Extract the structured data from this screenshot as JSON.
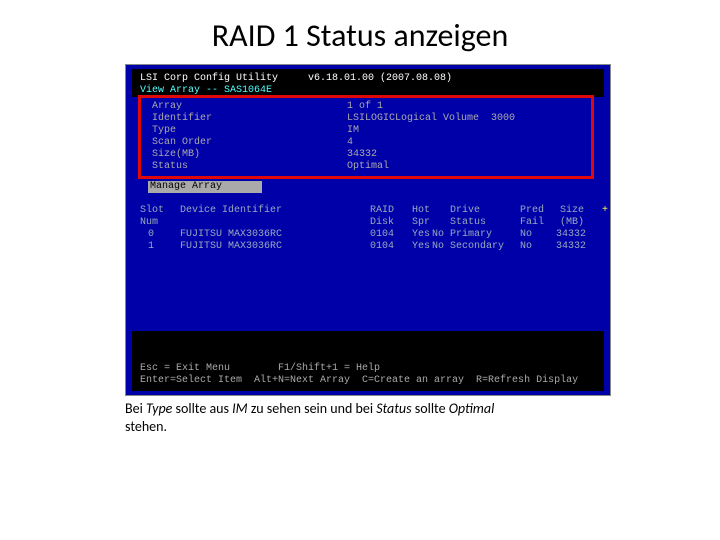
{
  "slide_title": "RAID 1 Status anzeigen",
  "header_line": "LSI Corp Config Utility     v6.18.01.00 (2007.08.08)",
  "subheader": "View Array -- SAS1064E",
  "array_labels": [
    "Array",
    "Identifier",
    "Type",
    "Scan Order",
    "Size(MB)",
    "Status"
  ],
  "array_values": [
    "1 of 1",
    "LSILOGICLogical Volume  3000",
    "IM",
    "4",
    "34332",
    "Optimal"
  ],
  "menu_item": "Manage Array",
  "tbl_h1": "Slot",
  "tbl_h2": "Num",
  "tbl_h3": "Device Identifier",
  "tbl_h4": "RAID",
  "tbl_h5": "Disk",
  "tbl_h6": "Hot",
  "tbl_h7": "Spr",
  "tbl_h8": "Drive",
  "tbl_h9": "Status",
  "tbl_h10": "Pred",
  "tbl_h11": "Fail",
  "tbl_h12": "Size",
  "tbl_h13": "(MB)",
  "row0_slot": "0",
  "row0_dev": "FUJITSU MAX3036RC",
  "row0_raid": "0104",
  "row0_hot": "Yes",
  "row0_spr": "No",
  "row0_stat": "Primary",
  "row0_pred": "No",
  "row0_size": "34332",
  "row1_slot": "1",
  "row1_dev": "FUJITSU MAX3036RC",
  "row1_raid": "0104",
  "row1_hot": "Yes",
  "row1_spr": "No",
  "row1_stat": "Secondary",
  "row1_pred": "No",
  "row1_size": "34332",
  "footer1": "Esc = Exit Menu        F1/Shift+1 = Help",
  "footer2": "Enter=Select Item  Alt+N=Next Array  C=Create an array  R=Refresh Display",
  "cap1": "Bei ",
  "cap2": "Type",
  "cap3": " sollte aus ",
  "cap4": "IM",
  "cap5": " zu sehen sein und bei ",
  "cap6": "Status",
  "cap7": " sollte ",
  "cap8": "Optimal",
  "cap9": " stehen."
}
